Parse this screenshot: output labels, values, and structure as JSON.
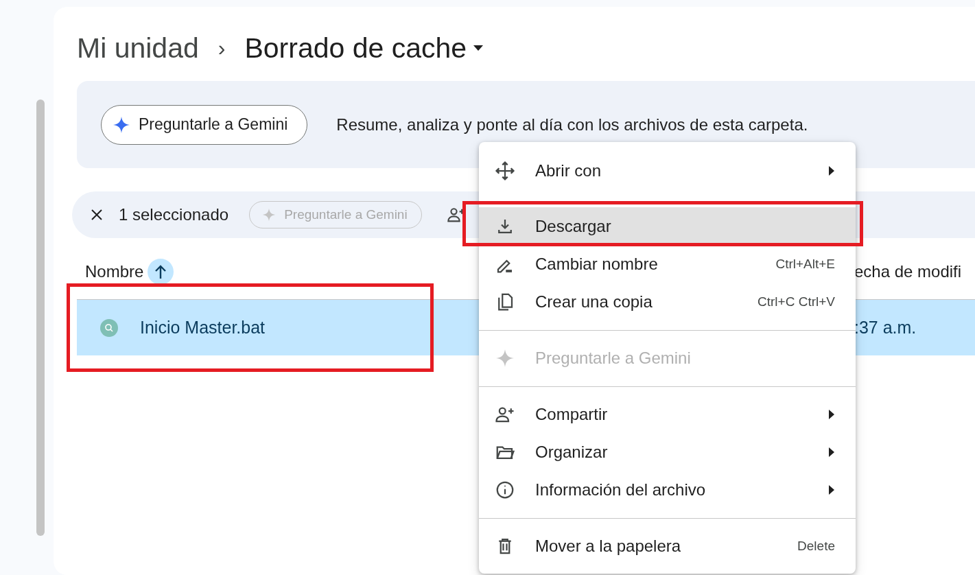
{
  "breadcrumb": {
    "parent": "Mi unidad",
    "separator": "›",
    "current": "Borrado de cache"
  },
  "gemini_banner": {
    "button": "Preguntarle a Gemini",
    "text": "Resume, analiza y ponte al día con los archivos de esta carpeta."
  },
  "selection_bar": {
    "count": "1 seleccionado",
    "gemini_button": {
      "label": "Preguntarle a Gemini",
      "disabled": true
    }
  },
  "table": {
    "columns": [
      {
        "label": "Nombre",
        "sorted": true
      },
      {
        "label": "echa de modifi",
        "sorted": false
      }
    ],
    "rows": [
      {
        "name": "Inicio Master.bat",
        "modified": ":37 a.m.",
        "selected": true
      }
    ]
  },
  "context_menu": {
    "groups": [
      [
        {
          "label": "Abrir con",
          "submenu": true,
          "highlighted": false,
          "disabled": false
        },
        {
          "label": "Descargar",
          "submenu": false,
          "highlighted": true,
          "disabled": false
        },
        {
          "label": "Cambiar nombre",
          "shortcut": "Ctrl+Alt+E",
          "submenu": false,
          "highlighted": false,
          "disabled": false
        },
        {
          "label": "Crear una copia",
          "shortcut": "Ctrl+C Ctrl+V",
          "submenu": false,
          "highlighted": false,
          "disabled": false
        }
      ],
      [
        {
          "label": "Preguntarle a Gemini",
          "submenu": false,
          "highlighted": false,
          "disabled": true
        }
      ],
      [
        {
          "label": "Compartir",
          "submenu": true,
          "highlighted": false,
          "disabled": false
        },
        {
          "label": "Organizar",
          "submenu": true,
          "highlighted": false,
          "disabled": false
        },
        {
          "label": "Información del archivo",
          "submenu": true,
          "highlighted": false,
          "disabled": false
        }
      ],
      [
        {
          "label": "Mover a la papelera",
          "shortcut": "Delete",
          "submenu": false,
          "highlighted": false,
          "disabled": false
        }
      ]
    ]
  }
}
